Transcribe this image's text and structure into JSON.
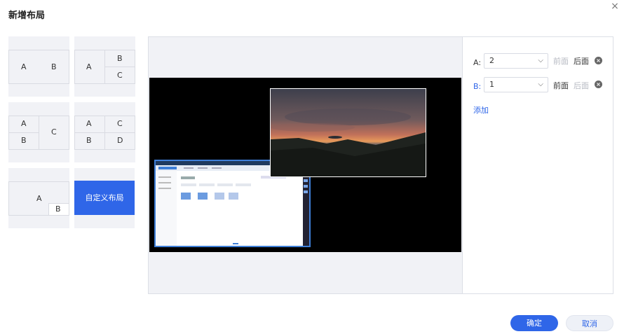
{
  "dialog": {
    "title": "新增布局",
    "close_glyph": "×"
  },
  "layouts": [
    {
      "id": "ab-horizontal",
      "labels": [
        "A",
        "B"
      ]
    },
    {
      "id": "a-bc",
      "labels": [
        "A",
        "B",
        "C"
      ]
    },
    {
      "id": "ab-c",
      "labels": [
        "A",
        "B",
        "C"
      ]
    },
    {
      "id": "abcd",
      "labels": [
        "A",
        "C",
        "B",
        "D"
      ]
    },
    {
      "id": "a-pip-b",
      "labels": [
        "A",
        "B"
      ]
    }
  ],
  "custom_layout": {
    "label": "自定义布局",
    "selected": true
  },
  "settings": {
    "rows": [
      {
        "label": "A:",
        "value": "2",
        "front": "前面",
        "back": "后面",
        "front_enabled": false,
        "back_enabled": true,
        "label_color": "#333333"
      },
      {
        "label": "B:",
        "value": "1",
        "front": "前面",
        "back": "后面",
        "front_enabled": true,
        "back_enabled": false,
        "label_color": "#2f66e8"
      }
    ],
    "add_label": "添加"
  },
  "footer": {
    "confirm": "确定",
    "cancel": "取消"
  },
  "colors": {
    "accent": "#2f66e8",
    "tile_bg": "#f1f2f6",
    "stage_bg": "#000000"
  }
}
